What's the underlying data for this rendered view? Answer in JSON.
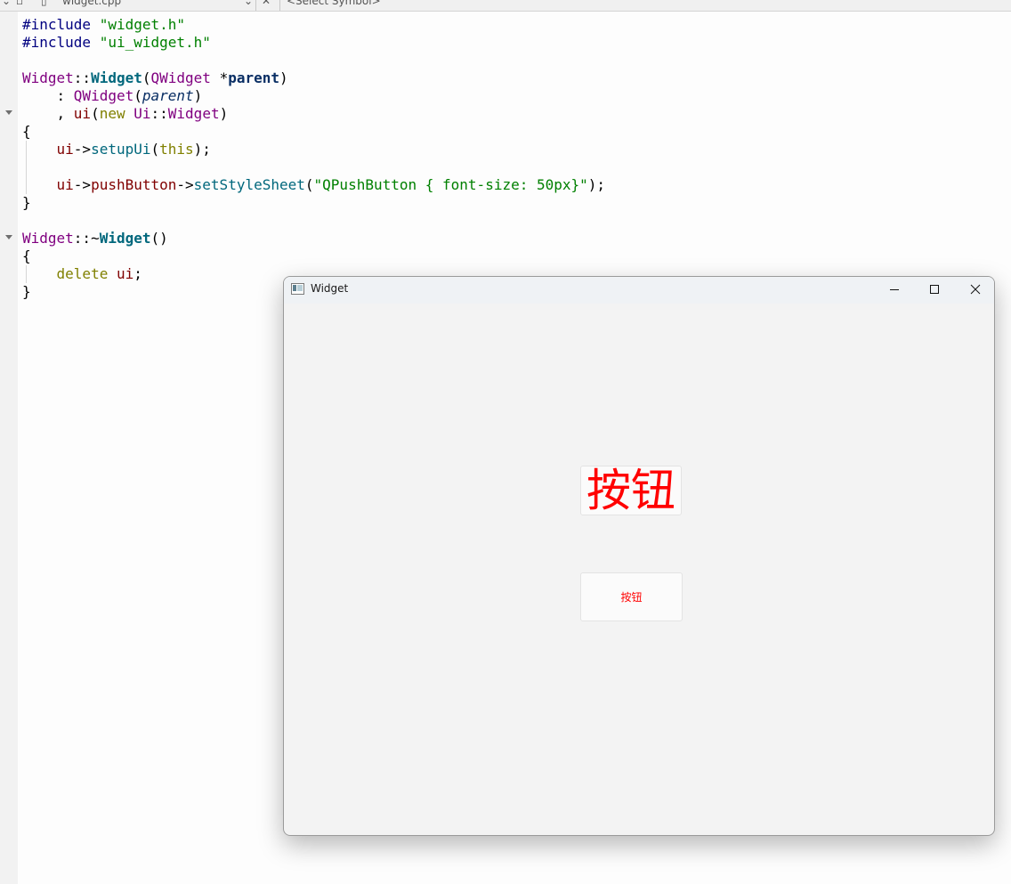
{
  "ide": {
    "file_tab": "widget.cpp",
    "symbol_selector": "<Select Symbol>"
  },
  "code_lines": [
    [
      [
        "#include ",
        "pp"
      ],
      [
        "\"widget.h\"",
        "str"
      ]
    ],
    [
      [
        "#include ",
        "pp"
      ],
      [
        "\"ui_widget.h\"",
        "str"
      ]
    ],
    [],
    [
      [
        "Widget",
        "cls"
      ],
      [
        "::",
        ""
      ],
      [
        "Widget",
        "fn"
      ],
      [
        "(",
        ""
      ],
      [
        "QWidget",
        "cls"
      ],
      [
        " *",
        ""
      ],
      [
        "parent",
        "param"
      ],
      [
        ")",
        ""
      ]
    ],
    [
      [
        "    : ",
        ""
      ],
      [
        "QWidget",
        "cls"
      ],
      [
        "(",
        ""
      ],
      [
        "parent",
        "it"
      ],
      [
        ")",
        ""
      ]
    ],
    [
      [
        "    , ",
        ""
      ],
      [
        "ui",
        "field"
      ],
      [
        "(",
        ""
      ],
      [
        "new",
        "kw"
      ],
      [
        " ",
        ""
      ],
      [
        "Ui",
        "cls"
      ],
      [
        "::",
        ""
      ],
      [
        "Widget",
        "cls"
      ],
      [
        ")",
        ""
      ]
    ],
    [
      [
        "{",
        ""
      ]
    ],
    [
      [
        "    ",
        ""
      ],
      [
        "ui",
        "field"
      ],
      [
        "->",
        ""
      ],
      [
        "setupUi",
        "call"
      ],
      [
        "(",
        ""
      ],
      [
        "this",
        "kw"
      ],
      [
        ");",
        ""
      ]
    ],
    [],
    [
      [
        "    ",
        ""
      ],
      [
        "ui",
        "field"
      ],
      [
        "->",
        ""
      ],
      [
        "pushButton",
        "field"
      ],
      [
        "->",
        ""
      ],
      [
        "setStyleSheet",
        "call"
      ],
      [
        "(",
        ""
      ],
      [
        "\"QPushButton { font-size: 50px}\"",
        "str"
      ],
      [
        ");",
        ""
      ]
    ],
    [
      [
        "}",
        ""
      ]
    ],
    [],
    [
      [
        "Widget",
        "cls"
      ],
      [
        "::~",
        ""
      ],
      [
        "Widget",
        "fn"
      ],
      [
        "()",
        ""
      ]
    ],
    [
      [
        "{",
        ""
      ]
    ],
    [
      [
        "    ",
        ""
      ],
      [
        "delete",
        "kw"
      ],
      [
        " ",
        ""
      ],
      [
        "ui",
        "field"
      ],
      [
        ";",
        ""
      ]
    ],
    [
      [
        "}",
        ""
      ]
    ]
  ],
  "window": {
    "title": "Widget",
    "minimize_icon": "minimize-icon",
    "maximize_icon": "maximize-icon",
    "close_icon": "close-icon"
  },
  "buttons": {
    "large_label": "按钮",
    "small_label": "按钮",
    "text_color": "#ff0000"
  }
}
